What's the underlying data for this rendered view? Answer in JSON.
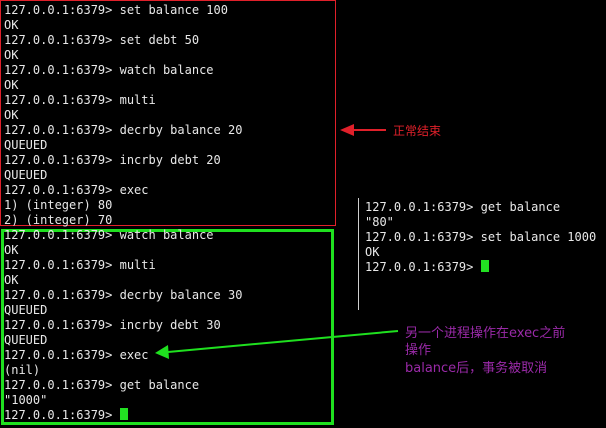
{
  "left_terminal": {
    "lines": [
      "127.0.0.1:6379> set balance 100",
      "OK",
      "127.0.0.1:6379> set debt 50",
      "OK",
      "127.0.0.1:6379> watch balance",
      "OK",
      "127.0.0.1:6379> multi",
      "OK",
      "127.0.0.1:6379> decrby balance 20",
      "QUEUED",
      "127.0.0.1:6379> incrby debt 20",
      "QUEUED",
      "127.0.0.1:6379> exec",
      "1) (integer) 80",
      "2) (integer) 70",
      "127.0.0.1:6379> watch balance",
      "OK",
      "127.0.0.1:6379> multi",
      "OK",
      "127.0.0.1:6379> decrby balance 30",
      "QUEUED",
      "127.0.0.1:6379> incrby debt 30",
      "QUEUED",
      "127.0.0.1:6379> exec",
      "(nil)",
      "127.0.0.1:6379> get balance",
      "\"1000\"",
      "127.0.0.1:6379> "
    ]
  },
  "right_terminal": {
    "lines": [
      "127.0.0.1:6379> get balance",
      "\"80\"",
      "127.0.0.1:6379> set balance 1000",
      "OK",
      "127.0.0.1:6379> "
    ]
  },
  "annotations": {
    "normal_end": "正常结束",
    "aborted_line1": "另一个进程操作在exec之前",
    "aborted_line2": "操作",
    "aborted_line3": "balance后，事务被取消"
  },
  "colors": {
    "background": "#000000",
    "text": "#e8e8e8",
    "red_box": "#e0202a",
    "green_box": "#1fe01f",
    "cursor": "#22e022",
    "annotation_purple": "#9a2aa8"
  }
}
